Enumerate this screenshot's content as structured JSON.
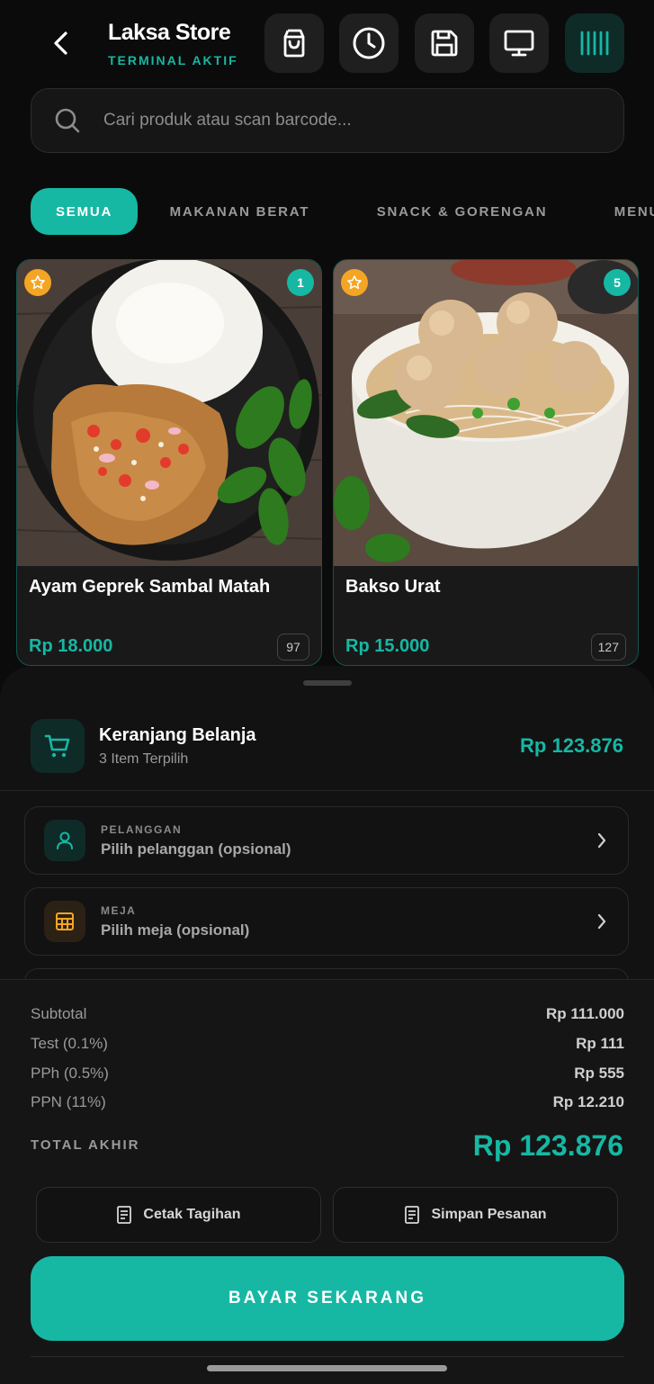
{
  "header": {
    "store_name": "Laksa Store",
    "terminal_status": "TERMINAL AKTIF",
    "icons": [
      "shopping-bag-icon",
      "clock-icon",
      "save-icon",
      "monitor-icon",
      "barcode-icon"
    ]
  },
  "search": {
    "placeholder": "Cari produk atau scan barcode..."
  },
  "categories": [
    {
      "label": "SEMUA",
      "active": true
    },
    {
      "label": "MAKANAN BERAT",
      "active": false
    },
    {
      "label": "SNACK & GORENGAN",
      "active": false
    },
    {
      "label": "MENU SPESIAL",
      "active": false
    }
  ],
  "products": [
    {
      "name": "Ayam Geprek Sambal Matah",
      "price": "Rp 18.000",
      "stock": "97",
      "in_cart": "1",
      "favorite": true
    },
    {
      "name": "Bakso Urat",
      "price": "Rp 15.000",
      "stock": "127",
      "in_cart": "5",
      "favorite": true
    }
  ],
  "cart": {
    "title": "Keranjang Belanja",
    "subtitle": "3 Item Terpilih",
    "total": "Rp 123.876"
  },
  "fields": [
    {
      "label": "PELANGGAN",
      "value": "Pilih pelanggan (opsional)"
    },
    {
      "label": "MEJA",
      "value": "Pilih meja (opsional)"
    }
  ],
  "summary": {
    "rows": [
      {
        "label": "Subtotal",
        "value": "Rp 111.000"
      },
      {
        "label": "Test (0.1%)",
        "value": "Rp 111"
      },
      {
        "label": "PPh (0.5%)",
        "value": "Rp 555"
      },
      {
        "label": "PPN (11%)",
        "value": "Rp 12.210"
      }
    ],
    "total_label": "TOTAL AKHIR",
    "total_value": "Rp 123.876"
  },
  "actions": {
    "print_bill": "Cetak Tagihan",
    "save_order": "Simpan Pesanan",
    "pay_now": "BAYAR SEKARANG"
  },
  "colors": {
    "accent": "#16b8a4",
    "star": "#f5a524",
    "background": "#0b0b0b"
  }
}
